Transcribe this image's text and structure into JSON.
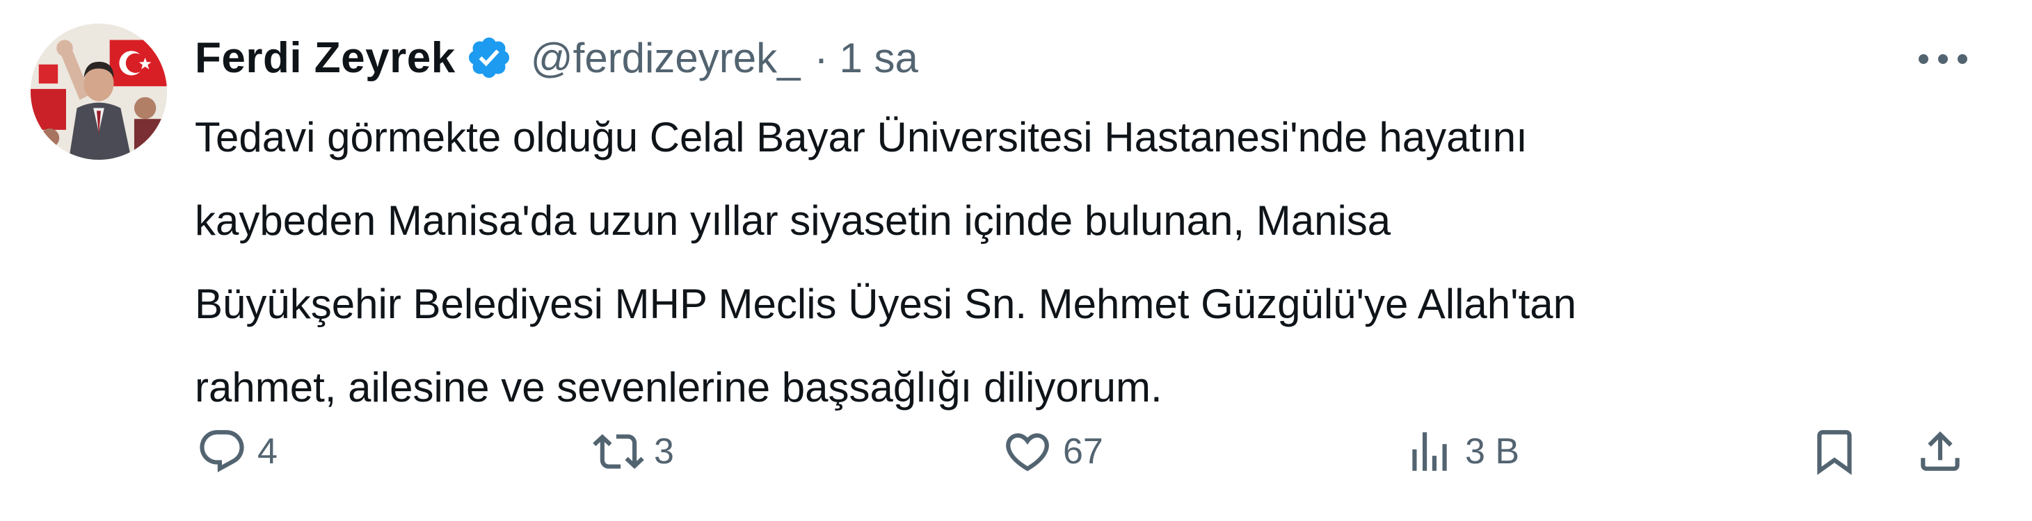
{
  "author": {
    "display_name": "Ferdi Zeyrek",
    "handle": "@ferdizeyrek_",
    "separator": "·",
    "timestamp": "1 sa",
    "verified_color": "#1d9bf0"
  },
  "tweet": {
    "lines": [
      "Tedavi görmekte olduğu Celal Bayar Üniversitesi Hastanesi'nde hayatını",
      "kaybeden Manisa'da uzun yıllar siyasetin içinde bulunan, Manisa",
      "Büyükşehir Belediyesi MHP Meclis Üyesi Sn. Mehmet Güzgülü'ye Allah'tan",
      "rahmet, ailesine ve sevenlerine başsağlığı diliyorum."
    ]
  },
  "actions": {
    "reply": {
      "icon": "reply-icon",
      "count": "4"
    },
    "retweet": {
      "icon": "retweet-icon",
      "count": "3"
    },
    "like": {
      "icon": "heart-icon",
      "count": "67"
    },
    "views": {
      "icon": "analytics-icon",
      "count": "3 B"
    },
    "bookmark": {
      "icon": "bookmark-icon"
    },
    "share": {
      "icon": "share-icon"
    }
  },
  "more": {
    "icon": "more-horizontal-icon"
  },
  "colors": {
    "text": "#0f1419",
    "muted": "#536471",
    "verified": "#1d9bf0",
    "background": "#ffffff"
  }
}
